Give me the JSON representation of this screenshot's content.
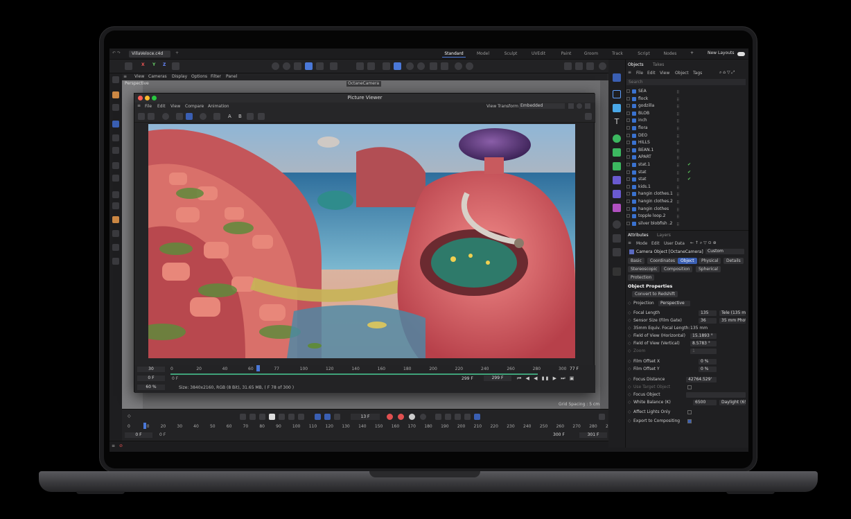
{
  "topbar": {
    "file_tab": "VillaVeloce.c4d",
    "layouts": [
      "Standard",
      "Model",
      "Sculpt",
      "UVEdit",
      "Paint",
      "Groom",
      "Track",
      "Script",
      "Nodes"
    ],
    "new_layouts": "New Layouts"
  },
  "toolbar": {
    "axes": [
      "X",
      "Y",
      "Z"
    ]
  },
  "viewport_menu": [
    "View",
    "Cameras",
    "Display",
    "Options",
    "Filter",
    "Panel"
  ],
  "viewport": {
    "label": "Perspective",
    "camera": "OctaneCamera",
    "grid_spacing": "Grid Spacing : 5 cm"
  },
  "picture_viewer": {
    "title": "Picture Viewer",
    "menu": [
      "File",
      "Edit",
      "View",
      "Compare",
      "Animation"
    ],
    "view_transform_label": "View Transform",
    "view_transform_value": "Embedded",
    "tools_text": [
      "A",
      "B"
    ],
    "frame_field": "30",
    "frame_start": "0 F",
    "frame_start2": "0 F",
    "ruler": [
      "0",
      "20",
      "40",
      "60",
      "77",
      "100",
      "120",
      "140",
      "160",
      "180",
      "200",
      "220",
      "240",
      "260",
      "280",
      "300"
    ],
    "current_frame": "77 F",
    "end_a": "299 F",
    "end_b": "299 F",
    "zoom": "60 %",
    "info": "Size: 3840x2160, RGB (8 Bit), 31.65 MB,  ( F 78 of 300 )"
  },
  "timeline": {
    "frame": "13 F",
    "ruler": [
      "0",
      "10",
      "20",
      "30",
      "40",
      "50",
      "60",
      "70",
      "80",
      "90",
      "100",
      "110",
      "120",
      "130",
      "140",
      "150",
      "160",
      "170",
      "180",
      "190",
      "200",
      "210",
      "220",
      "230",
      "240",
      "250",
      "260",
      "270",
      "280",
      "290"
    ],
    "start_a": "0 F",
    "start_b": "0 F",
    "end_a": "300 F",
    "end_b": "301 F"
  },
  "objects_panel": {
    "tabs": [
      "Objects",
      "Takes"
    ],
    "menu": [
      "File",
      "Edit",
      "View",
      "Object",
      "Tags"
    ],
    "search_placeholder": "Search",
    "items": [
      {
        "name": "SEA",
        "check": false
      },
      {
        "name": "flock",
        "check": false
      },
      {
        "name": "godzilla",
        "check": false
      },
      {
        "name": "BLOB",
        "check": false
      },
      {
        "name": "inch",
        "check": false
      },
      {
        "name": "flora",
        "check": false
      },
      {
        "name": "DEO",
        "check": false
      },
      {
        "name": "HILLS",
        "check": false
      },
      {
        "name": "BEAN.1",
        "check": false
      },
      {
        "name": "APART",
        "check": false
      },
      {
        "name": "stat.1",
        "check": true
      },
      {
        "name": "stat",
        "check": true
      },
      {
        "name": "stat",
        "check": true
      },
      {
        "name": "kids.1",
        "check": false
      },
      {
        "name": "hangin clothes.1",
        "check": false
      },
      {
        "name": "hangin clothes.2",
        "check": false
      },
      {
        "name": "hangin clothes",
        "check": false
      },
      {
        "name": "topple loop.2",
        "check": false
      },
      {
        "name": "silver blobfish .2",
        "check": false
      }
    ]
  },
  "attributes_panel": {
    "tabs": [
      "Attributes",
      "Layers"
    ],
    "menu": [
      "Mode",
      "Edit",
      "User Data"
    ],
    "object_name": "Camera Object [OctaneCamera]",
    "preset": "Custom",
    "subtabs_row1": [
      "Basic",
      "Coordinates",
      "Object",
      "Physical",
      "Details"
    ],
    "subtabs_row2": [
      "Stereoscopic",
      "Composition",
      "Spherical"
    ],
    "protection": "Protection",
    "section_title": "Object Properties",
    "convert_button": "Convert to Redshift",
    "projection_label": "Projection",
    "projection_value": "Perspective",
    "focal_length_label": "Focal Length",
    "focal_length_value": "135",
    "focal_length_preset": "Tele (135 mm",
    "sensor_label": "Sensor Size (Film Gate)",
    "sensor_value": "36",
    "sensor_preset": "35 mm Phot",
    "equiv_label": "35mm Equiv. Focal Length:",
    "equiv_value": "135 mm",
    "fov_h_label": "Field of View (Horizontal)",
    "fov_h_value": "15.1893 °",
    "fov_v_label": "Field of View (Vertical)",
    "fov_v_value": "8.5783 °",
    "zoom_label": "Zoom",
    "zoom_value": "1",
    "offx_label": "Film Offset X",
    "offx_value": "0 %",
    "offy_label": "Film Offset Y",
    "offy_value": "0 %",
    "focus_label": "Focus Distance",
    "focus_value": "42764.529'",
    "use_target_label": "Use Target Object",
    "focus_obj_label": "Focus Object",
    "wb_label": "White Balance (K)",
    "wb_value": "6500",
    "wb_preset": "Daylight (65",
    "affect_label": "Affect Lights Only",
    "export_label": "Export to Compositing"
  },
  "colors": {
    "accent": "#4a78d8",
    "check": "#5cc85c",
    "red_dot": "#ff5f57",
    "yellow_dot": "#febc2e",
    "green_dot": "#28c840",
    "timeline_bar": "#3fa37a"
  }
}
